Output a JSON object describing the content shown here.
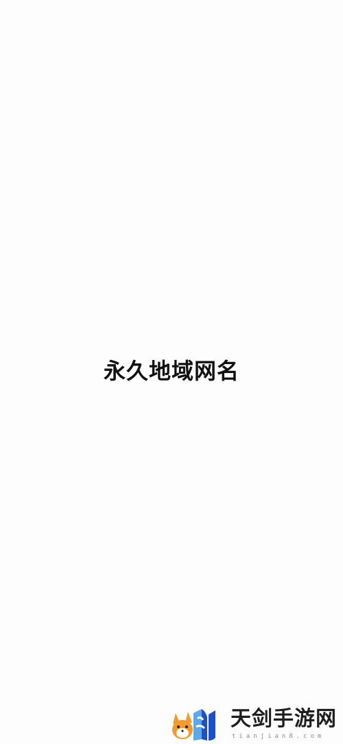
{
  "page": {
    "title": "永久地域网名"
  },
  "watermark": {
    "brand": "天剑手游网",
    "domain": "tianjian8.com",
    "logo_icon": "fox-logo-icon",
    "accent_orange": "#f39a2b",
    "accent_blue": "#1d4fc9"
  }
}
